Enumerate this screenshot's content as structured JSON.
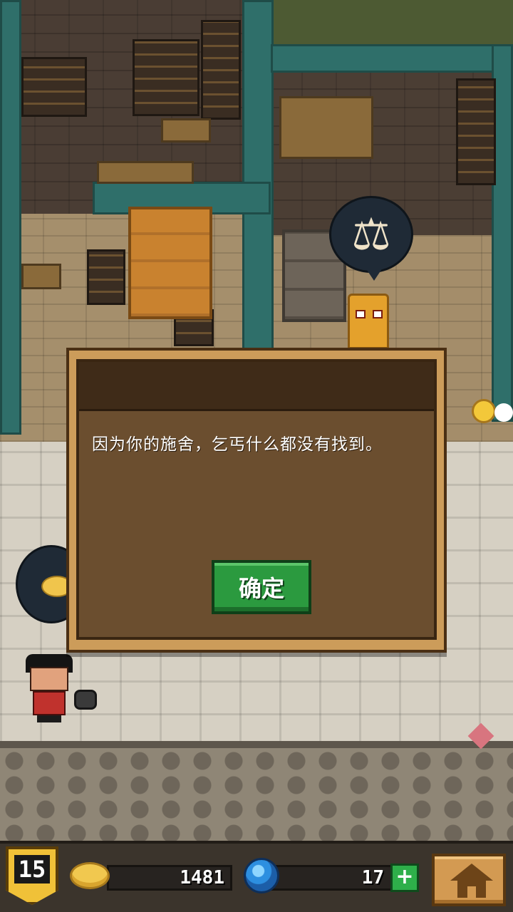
{
  "dialog": {
    "message": "因为你的施舍，乞丐什么都没有找到。",
    "confirm_label": "确定"
  },
  "hud": {
    "level": "15",
    "gold": "1481",
    "gems": "17",
    "plus_label": "+"
  },
  "icons": {
    "shop_bubble": "balance-scale-icon",
    "gold": "coin-icon",
    "gems": "blue-gem-icon",
    "home": "home-icon"
  },
  "colors": {
    "confirm_button": "#2b9a3f",
    "level_badge": "#f0c138",
    "dialog_panel": "#6b4e2f"
  }
}
